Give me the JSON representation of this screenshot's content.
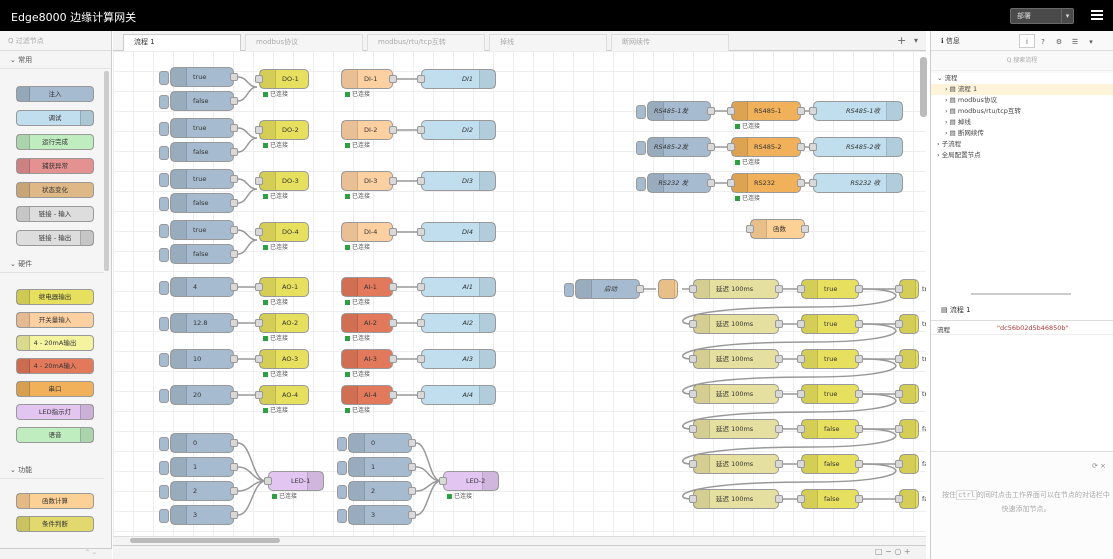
{
  "app": {
    "title": "Edge8000 边缘计算网关",
    "deploy_label": "部署"
  },
  "palette": {
    "search_placeholder": "Q 过滤节点",
    "categories": [
      "常用",
      "硬件",
      "功能"
    ],
    "common": [
      "注入",
      "调试",
      "运行完成",
      "捕获异常",
      "状态变化",
      "链接 - 输入",
      "链接 - 输出"
    ],
    "hardware": [
      "继电器输出",
      "开关量输入",
      "4 - 20mA输出",
      "4 - 20mA输入",
      "串口",
      "LED指示灯",
      "语音"
    ],
    "function": [
      "函数计算",
      "条件判断"
    ]
  },
  "tabs": [
    "流程 1",
    "modbus协议",
    "modbus/rtu/tcp互转",
    "掉线",
    "断网续传"
  ],
  "flow": {
    "status_connected": "已连接",
    "inject_values": [
      "true",
      "false",
      "true",
      "false",
      "true",
      "false",
      "true",
      "false"
    ],
    "do_labels": [
      "DO-1",
      "DO-2",
      "DO-3",
      "DO-4"
    ],
    "di_labels": [
      "DI-1",
      "DI-2",
      "DI-3",
      "DI-4"
    ],
    "di_debug": [
      "DI1",
      "DI2",
      "DI3",
      "DI4"
    ],
    "ao_inject": [
      "4",
      "12.8",
      "10",
      "20"
    ],
    "ao_labels": [
      "AO-1",
      "AO-2",
      "AO-3",
      "AO-4"
    ],
    "ai_labels": [
      "AI-1",
      "AI-2",
      "AI-3",
      "AI-4"
    ],
    "ai_debug": [
      "AI1",
      "AI2",
      "AI3",
      "AI4"
    ],
    "led_inject": [
      "0",
      "1",
      "2",
      "3"
    ],
    "led_labels": [
      "LED-1",
      "LED-2"
    ],
    "serial_inject": [
      "RS485-1发",
      "RS485-2发",
      "RS232 发"
    ],
    "serial_nodes": [
      "RS485-1",
      "RS485-2",
      "RS232"
    ],
    "serial_debug": [
      "RS485-1收",
      "RS485-2收",
      "RS232 收"
    ],
    "function_label": "函数",
    "start_label": "启动",
    "delay_label": "延迟 100ms",
    "seq_values": [
      "true",
      "true",
      "true",
      "true",
      "false",
      "false",
      "false"
    ]
  },
  "sidebar": {
    "title": "信息",
    "search_placeholder": "Q 搜索流程",
    "tree": [
      "流程",
      "流程 1",
      "modbus协议",
      "modbus/rtu/tcp互转",
      "掉线",
      "断网续传",
      "子流程",
      "全局配置节点"
    ],
    "selected_title": "流程 1",
    "prop_key": "流程",
    "prop_value": "\"dc56b02d5b46850b\"",
    "help_pre": "按住",
    "help_key": "ctrl",
    "help_post": "的同时点击工作界面可以在节点的对话栏中快速添加节点。"
  },
  "colors": {
    "inject": "#a6bbcf",
    "gpio": "#e6e05e",
    "input": "#fdd0a2",
    "debug": "#c0deed",
    "ai": "#e2795b",
    "led": "#e2c5f0",
    "serial": "#f0b15a",
    "delay": "#e6e0a0",
    "function": "#fdd095"
  }
}
